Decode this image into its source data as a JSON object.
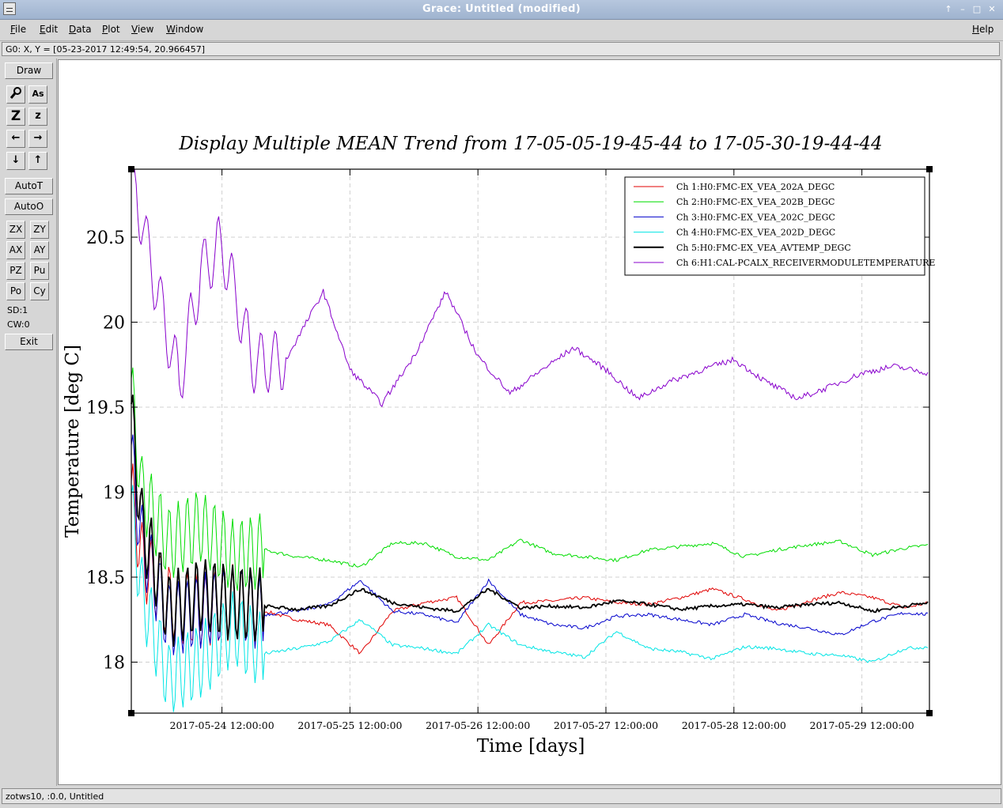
{
  "window": {
    "title": "Grace: Untitled (modified)",
    "controls": [
      "↑",
      "–",
      "□",
      "✕"
    ]
  },
  "menubar": {
    "items": [
      {
        "label": "File",
        "underline": "F",
        "rest": "ile"
      },
      {
        "label": "Edit",
        "underline": "E",
        "rest": "dit"
      },
      {
        "label": "Data",
        "underline": "D",
        "rest": "ata"
      },
      {
        "label": "Plot",
        "underline": "P",
        "rest": "lot"
      },
      {
        "label": "View",
        "underline": "V",
        "rest": "iew"
      },
      {
        "label": "Window",
        "underline": "W",
        "rest": "indow"
      }
    ],
    "help": {
      "label": "Help",
      "underline": "H",
      "rest": "elp"
    }
  },
  "locator": {
    "text": "G0: X, Y = [05-23-2017 12:49:54, 20.966457]"
  },
  "toolbar": {
    "draw": "Draw",
    "zoom_icon": "magnifier-icon",
    "autoscale_text_icon": "As",
    "z_big": "Z",
    "z_small": "z",
    "left_icon": "←",
    "right_icon": "→",
    "down_icon": "↓",
    "up_icon": "↑",
    "autot": "AutoT",
    "autoo": "AutoO",
    "grid": [
      "ZX",
      "ZY",
      "AX",
      "AY",
      "PZ",
      "Pu",
      "Po",
      "Cy"
    ],
    "sd": "SD:1",
    "cw": "CW:0",
    "exit": "Exit"
  },
  "status": {
    "text": "zotws10, :0.0, Untitled"
  },
  "chart_data": {
    "type": "line",
    "title": "Display Multiple MEAN Trend from 17-05-05-19-45-44 to 17-05-30-19-44-44",
    "xlabel": "Time [days]",
    "ylabel": "Temperature [deg C]",
    "xlim": [
      "2017-05-23 19:00:00",
      "2017-05-30 00:40:00"
    ],
    "ylim": [
      17.7,
      20.9
    ],
    "x_ticks": [
      "2017-05-24 12:00:00",
      "2017-05-25 12:00:00",
      "2017-05-26 12:00:00",
      "2017-05-27 12:00:00",
      "2017-05-28 12:00:00",
      "2017-05-29 12:00:00"
    ],
    "y_ticks": [
      "18",
      "18.5",
      "19",
      "19.5",
      "20",
      "20.5"
    ],
    "grid": true,
    "legend_position": "top-right",
    "series": [
      {
        "name": "Ch 1:H0:FMC-EX_VEA_202A_DEGC",
        "color": "#e00000",
        "x": [
          "2017-05-23 19:00",
          "2017-05-23 21:00",
          "2017-05-24 02:00",
          "2017-05-24 08:00",
          "2017-05-24 14:00",
          "2017-05-24 20:00",
          "2017-05-25 02:00",
          "2017-05-25 08:00",
          "2017-05-25 14:00",
          "2017-05-25 20:00",
          "2017-05-26 02:00",
          "2017-05-26 08:00",
          "2017-05-26 14:00",
          "2017-05-26 20:00",
          "2017-05-27 02:00",
          "2017-05-27 08:00",
          "2017-05-27 14:00",
          "2017-05-27 20:00",
          "2017-05-28 02:00",
          "2017-05-28 08:00",
          "2017-05-28 14:00",
          "2017-05-28 20:00",
          "2017-05-29 02:00",
          "2017-05-29 08:00",
          "2017-05-29 14:00",
          "2017-05-29 20:00",
          "2017-05-30 00:40"
        ],
        "values": [
          19.0,
          18.6,
          18.35,
          18.3,
          18.35,
          18.3,
          18.25,
          18.22,
          18.05,
          18.3,
          18.35,
          18.38,
          18.1,
          18.35,
          18.36,
          18.38,
          18.35,
          18.34,
          18.38,
          18.43,
          18.37,
          18.3,
          18.36,
          18.41,
          18.38,
          18.32,
          18.35
        ]
      },
      {
        "name": "Ch 2:H0:FMC-EX_VEA_202B_DEGC",
        "color": "#00dd00",
        "x": [
          "2017-05-23 19:00",
          "2017-05-23 21:00",
          "2017-05-24 02:00",
          "2017-05-24 08:00",
          "2017-05-24 14:00",
          "2017-05-24 20:00",
          "2017-05-25 02:00",
          "2017-05-25 08:00",
          "2017-05-25 14:00",
          "2017-05-25 20:00",
          "2017-05-26 02:00",
          "2017-05-26 08:00",
          "2017-05-26 14:00",
          "2017-05-26 20:00",
          "2017-05-27 02:00",
          "2017-05-27 08:00",
          "2017-05-27 14:00",
          "2017-05-27 20:00",
          "2017-05-28 02:00",
          "2017-05-28 08:00",
          "2017-05-28 14:00",
          "2017-05-28 20:00",
          "2017-05-29 02:00",
          "2017-05-29 08:00",
          "2017-05-29 14:00",
          "2017-05-29 20:00",
          "2017-05-30 00:40"
        ],
        "values": [
          19.6,
          19.0,
          18.7,
          18.8,
          18.62,
          18.66,
          18.62,
          18.6,
          18.56,
          18.7,
          18.7,
          18.62,
          18.6,
          18.72,
          18.64,
          18.62,
          18.6,
          18.66,
          18.68,
          18.7,
          18.62,
          18.66,
          18.69,
          18.71,
          18.63,
          18.67,
          18.69
        ]
      },
      {
        "name": "Ch 3:H0:FMC-EX_VEA_202C_DEGC",
        "color": "#0000cc",
        "x": [
          "2017-05-23 19:00",
          "2017-05-23 21:00",
          "2017-05-24 02:00",
          "2017-05-24 08:00",
          "2017-05-24 14:00",
          "2017-05-24 20:00",
          "2017-05-25 02:00",
          "2017-05-25 08:00",
          "2017-05-25 14:00",
          "2017-05-25 20:00",
          "2017-05-26 02:00",
          "2017-05-26 08:00",
          "2017-05-26 14:00",
          "2017-05-26 20:00",
          "2017-05-27 02:00",
          "2017-05-27 08:00",
          "2017-05-27 14:00",
          "2017-05-27 20:00",
          "2017-05-28 02:00",
          "2017-05-28 08:00",
          "2017-05-28 14:00",
          "2017-05-28 20:00",
          "2017-05-29 02:00",
          "2017-05-29 08:00",
          "2017-05-29 14:00",
          "2017-05-29 20:00",
          "2017-05-30 00:40"
        ],
        "values": [
          19.2,
          18.7,
          18.25,
          18.3,
          18.35,
          18.28,
          18.3,
          18.34,
          18.48,
          18.3,
          18.28,
          18.23,
          18.48,
          18.28,
          18.22,
          18.2,
          18.27,
          18.28,
          18.25,
          18.22,
          18.28,
          18.23,
          18.2,
          18.16,
          18.24,
          18.29,
          18.28
        ]
      },
      {
        "name": "Ch 4:H0:FMC-EX_VEA_202D_DEGC",
        "color": "#00e5e5",
        "x": [
          "2017-05-23 19:00",
          "2017-05-23 21:00",
          "2017-05-24 02:00",
          "2017-05-24 08:00",
          "2017-05-24 14:00",
          "2017-05-24 20:00",
          "2017-05-25 02:00",
          "2017-05-25 08:00",
          "2017-05-25 14:00",
          "2017-05-25 20:00",
          "2017-05-26 02:00",
          "2017-05-26 08:00",
          "2017-05-26 14:00",
          "2017-05-26 20:00",
          "2017-05-27 02:00",
          "2017-05-27 08:00",
          "2017-05-27 14:00",
          "2017-05-27 20:00",
          "2017-05-28 02:00",
          "2017-05-28 08:00",
          "2017-05-28 14:00",
          "2017-05-28 20:00",
          "2017-05-29 02:00",
          "2017-05-29 08:00",
          "2017-05-29 14:00",
          "2017-05-29 20:00",
          "2017-05-30 00:40"
        ],
        "values": [
          18.9,
          18.4,
          17.9,
          18.0,
          18.2,
          18.05,
          18.08,
          18.12,
          18.25,
          18.1,
          18.08,
          18.05,
          18.22,
          18.1,
          18.06,
          18.03,
          18.18,
          18.08,
          18.06,
          18.02,
          18.09,
          18.08,
          18.05,
          18.04,
          18.0,
          18.08,
          18.09
        ]
      },
      {
        "name": "Ch 5:H0:FMC-EX_VEA_AVTEMP_DEGC",
        "color": "#000000",
        "x": [
          "2017-05-23 19:00",
          "2017-05-23 21:00",
          "2017-05-24 02:00",
          "2017-05-24 08:00",
          "2017-05-24 14:00",
          "2017-05-24 20:00",
          "2017-05-25 02:00",
          "2017-05-25 08:00",
          "2017-05-25 14:00",
          "2017-05-25 20:00",
          "2017-05-26 02:00",
          "2017-05-26 08:00",
          "2017-05-26 14:00",
          "2017-05-26 20:00",
          "2017-05-27 02:00",
          "2017-05-27 08:00",
          "2017-05-27 14:00",
          "2017-05-27 20:00",
          "2017-05-28 02:00",
          "2017-05-28 08:00",
          "2017-05-28 14:00",
          "2017-05-28 20:00",
          "2017-05-29 02:00",
          "2017-05-29 08:00",
          "2017-05-29 14:00",
          "2017-05-29 20:00",
          "2017-05-30 00:40"
        ],
        "values": [
          19.45,
          18.8,
          18.3,
          18.4,
          18.35,
          18.33,
          18.31,
          18.33,
          18.43,
          18.35,
          18.32,
          18.3,
          18.43,
          18.32,
          18.33,
          18.32,
          18.36,
          18.34,
          18.31,
          18.33,
          18.34,
          18.32,
          18.34,
          18.35,
          18.3,
          18.33,
          18.35
        ]
      },
      {
        "name": "Ch 6:H1:CAL-PCALX_RECEIVERMODULETEMPERATURE",
        "color": "#8800cc",
        "x": [
          "2017-05-23 19:00",
          "2017-05-23 23:00",
          "2017-05-24 04:00",
          "2017-05-24 08:00",
          "2017-05-24 12:00",
          "2017-05-24 18:00",
          "2017-05-25 00:00",
          "2017-05-25 07:00",
          "2017-05-25 12:00",
          "2017-05-25 18:00",
          "2017-05-26 00:00",
          "2017-05-26 06:00",
          "2017-05-26 12:00",
          "2017-05-26 18:00",
          "2017-05-27 00:00",
          "2017-05-27 06:00",
          "2017-05-27 12:00",
          "2017-05-27 18:00",
          "2017-05-28 00:00",
          "2017-05-28 06:00",
          "2017-05-28 12:00",
          "2017-05-28 18:00",
          "2017-05-29 00:00",
          "2017-05-29 06:00",
          "2017-05-29 12:00",
          "2017-05-29 18:00",
          "2017-05-30 00:40"
        ],
        "values": [
          20.9,
          20.3,
          19.65,
          20.3,
          20.45,
          19.75,
          19.78,
          20.18,
          19.72,
          19.52,
          19.8,
          20.18,
          19.8,
          19.58,
          19.72,
          19.85,
          19.72,
          19.55,
          19.65,
          19.72,
          19.78,
          19.65,
          19.55,
          19.62,
          19.7,
          19.74,
          19.7
        ]
      }
    ]
  }
}
